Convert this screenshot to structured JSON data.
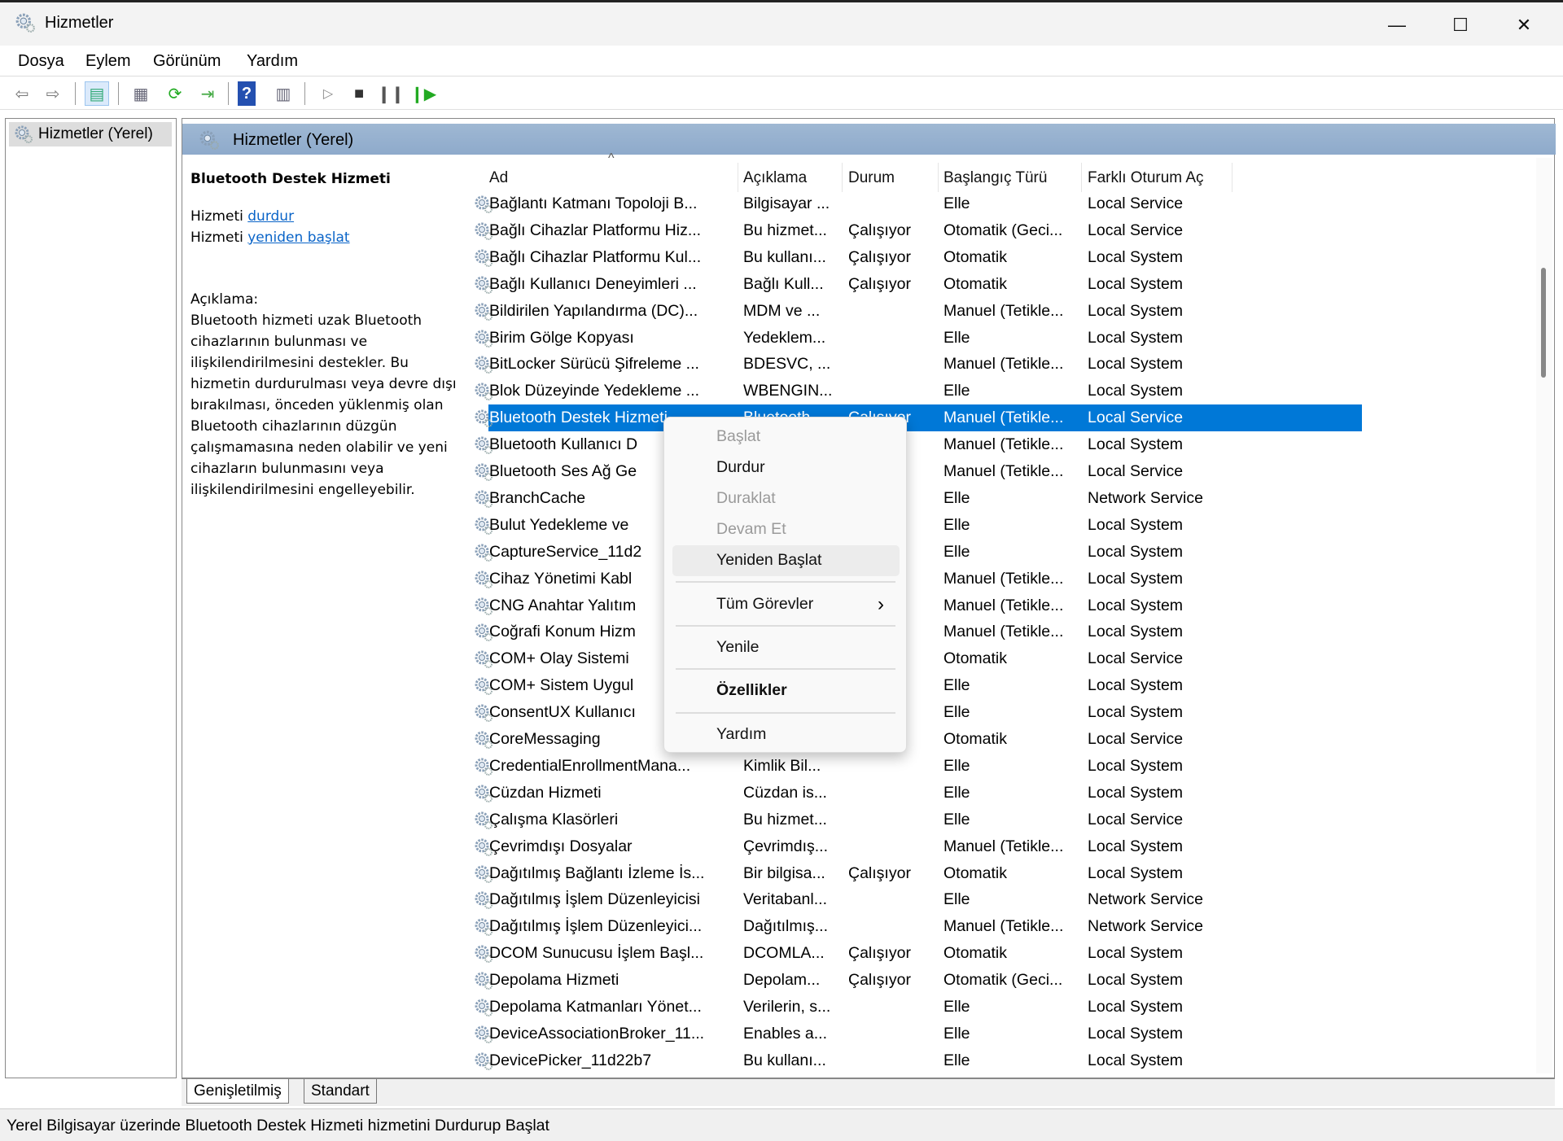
{
  "window": {
    "title": "Hizmetler",
    "minimize": "—",
    "maximize": "☐",
    "close": "✕"
  },
  "menubar": [
    "Dosya",
    "Eylem",
    "Görünüm",
    "Yardım"
  ],
  "toolbar": [
    "back-icon",
    "forward-icon",
    "show-hide-tree-icon",
    "properties-icon",
    "refresh-icon",
    "export-list-icon",
    "help-icon",
    "action-pane-icon",
    "start-service-icon",
    "stop-service-icon",
    "pause-service-icon",
    "resume-service-icon"
  ],
  "tree": {
    "root": "Hizmetler (Yerel)"
  },
  "pane": {
    "title": "Hizmetler (Yerel)"
  },
  "details": {
    "service_name": "Bluetooth Destek Hizmeti",
    "stop_prefix": "Hizmeti ",
    "stop_link": "durdur",
    "restart_prefix": "Hizmeti ",
    "restart_link": "yeniden başlat",
    "desc_label": "Açıklama:",
    "description": "Bluetooth hizmeti uzak Bluetooth cihazlarının bulunması ve ilişkilendirilmesini destekler. Bu hizmetin durdurulması veya devre dışı bırakılması, önceden yüklenmiş olan Bluetooth cihazlarının düzgün çalışmamasına neden olabilir ve yeni cihazların bulunmasını veya ilişkilendirilmesini engelleyebilir."
  },
  "columns": [
    "Ad",
    "Açıklama",
    "Durum",
    "Başlangıç Türü",
    "Farklı Oturum Aç"
  ],
  "sort_indicator": "^",
  "selected_row": 8,
  "rows": [
    [
      "Bağlantı Katmanı Topoloji B...",
      "Bilgisayar ...",
      "",
      "Elle",
      "Local Service"
    ],
    [
      "Bağlı Cihazlar Platformu Hiz...",
      "Bu hizmet...",
      "Çalışıyor",
      "Otomatik (Geci...",
      "Local Service"
    ],
    [
      "Bağlı Cihazlar Platformu Kul...",
      "Bu kullanı...",
      "Çalışıyor",
      "Otomatik",
      "Local System"
    ],
    [
      "Bağlı Kullanıcı Deneyimleri ...",
      "Bağlı Kull...",
      "Çalışıyor",
      "Otomatik",
      "Local System"
    ],
    [
      "Bildirilen Yapılandırma (DC)...",
      "MDM ve ...",
      "",
      "Manuel (Tetikle...",
      "Local System"
    ],
    [
      "Birim Gölge Kopyası",
      "Yedeklem...",
      "",
      "Elle",
      "Local System"
    ],
    [
      "BitLocker Sürücü Şifreleme ...",
      "BDESVC, ...",
      "",
      "Manuel (Tetikle...",
      "Local System"
    ],
    [
      "Blok Düzeyinde Yedekleme ...",
      "WBENGIN...",
      "",
      "Elle",
      "Local System"
    ],
    [
      "Bluetooth Destek Hizmeti",
      "Bluetooth...",
      "Çalışıyor",
      "Manuel (Tetikle...",
      "Local Service"
    ],
    [
      "Bluetooth Kullanıcı D",
      "",
      "",
      "Manuel (Tetikle...",
      "Local System"
    ],
    [
      "Bluetooth Ses Ağ Ge",
      "",
      "",
      "Manuel (Tetikle...",
      "Local Service"
    ],
    [
      "BranchCache",
      "",
      "",
      "Elle",
      "Network Service"
    ],
    [
      "Bulut Yedekleme ve",
      "",
      "",
      "Elle",
      "Local System"
    ],
    [
      "CaptureService_11d2",
      "",
      "",
      "Elle",
      "Local System"
    ],
    [
      "Cihaz Yönetimi Kabl",
      "",
      "",
      "Manuel (Tetikle...",
      "Local System"
    ],
    [
      "CNG Anahtar Yalıtım",
      "",
      "",
      "Manuel (Tetikle...",
      "Local System"
    ],
    [
      "Coğrafi Konum Hizm",
      "",
      "",
      "Manuel (Tetikle...",
      "Local System"
    ],
    [
      "COM+ Olay Sistemi",
      "",
      "",
      "Otomatik",
      "Local Service"
    ],
    [
      "COM+ Sistem Uygul",
      "",
      "",
      "Elle",
      "Local System"
    ],
    [
      "ConsentUX Kullanıcı",
      "",
      "",
      "Elle",
      "Local System"
    ],
    [
      "CoreMessaging",
      "",
      "",
      "Otomatik",
      "Local Service"
    ],
    [
      "CredentialEnrollmentMana...",
      "Kimlik Bil...",
      "",
      "Elle",
      "Local System"
    ],
    [
      "Cüzdan Hizmeti",
      "Cüzdan is...",
      "",
      "Elle",
      "Local System"
    ],
    [
      "Çalışma Klasörleri",
      "Bu hizmet...",
      "",
      "Elle",
      "Local Service"
    ],
    [
      "Çevrimdışı Dosyalar",
      "Çevrimdış...",
      "",
      "Manuel (Tetikle...",
      "Local System"
    ],
    [
      "Dağıtılmış Bağlantı İzleme İs...",
      "Bir bilgisa...",
      "Çalışıyor",
      "Otomatik",
      "Local System"
    ],
    [
      "Dağıtılmış İşlem Düzenleyicisi",
      "Veritabanl...",
      "",
      "Elle",
      "Network Service"
    ],
    [
      "Dağıtılmış İşlem Düzenleyici...",
      "Dağıtılmış...",
      "",
      "Manuel (Tetikle...",
      "Network Service"
    ],
    [
      "DCOM Sunucusu İşlem Başl...",
      "DCOMLA...",
      "Çalışıyor",
      "Otomatik",
      "Local System"
    ],
    [
      "Depolama Hizmeti",
      "Depolam...",
      "Çalışıyor",
      "Otomatik (Geci...",
      "Local System"
    ],
    [
      "Depolama Katmanları Yönet...",
      "Verilerin, s...",
      "",
      "Elle",
      "Local System"
    ],
    [
      "DeviceAssociationBroker_11...",
      "Enables a...",
      "",
      "Elle",
      "Local System"
    ],
    [
      "DevicePicker_11d22b7",
      "Bu kullanı...",
      "",
      "Elle",
      "Local System"
    ]
  ],
  "context_menu": {
    "items": [
      {
        "label": "Başlat",
        "disabled": true
      },
      {
        "label": "Durdur",
        "disabled": false
      },
      {
        "label": "Duraklat",
        "disabled": true
      },
      {
        "label": "Devam Et",
        "disabled": true
      },
      {
        "label": "Yeniden Başlat",
        "disabled": false,
        "hovered": true
      },
      {
        "label": "Tüm Görevler",
        "disabled": false,
        "submenu": true
      },
      {
        "label": "Yenile",
        "disabled": false
      },
      {
        "label": "Özellikler",
        "disabled": false,
        "bold": true
      },
      {
        "label": "Yardım",
        "disabled": false
      }
    ],
    "submenu_arrow": "›"
  },
  "tabs": [
    "Genişletilmiş",
    "Standart"
  ],
  "status_bar": "Yerel Bilgisayar üzerinde Bluetooth Destek Hizmeti hizmetini Durdurup Başlat",
  "colors": {
    "selection": "#0078d7",
    "header_band": "#9fb8d3",
    "link": "#0a64c8"
  }
}
